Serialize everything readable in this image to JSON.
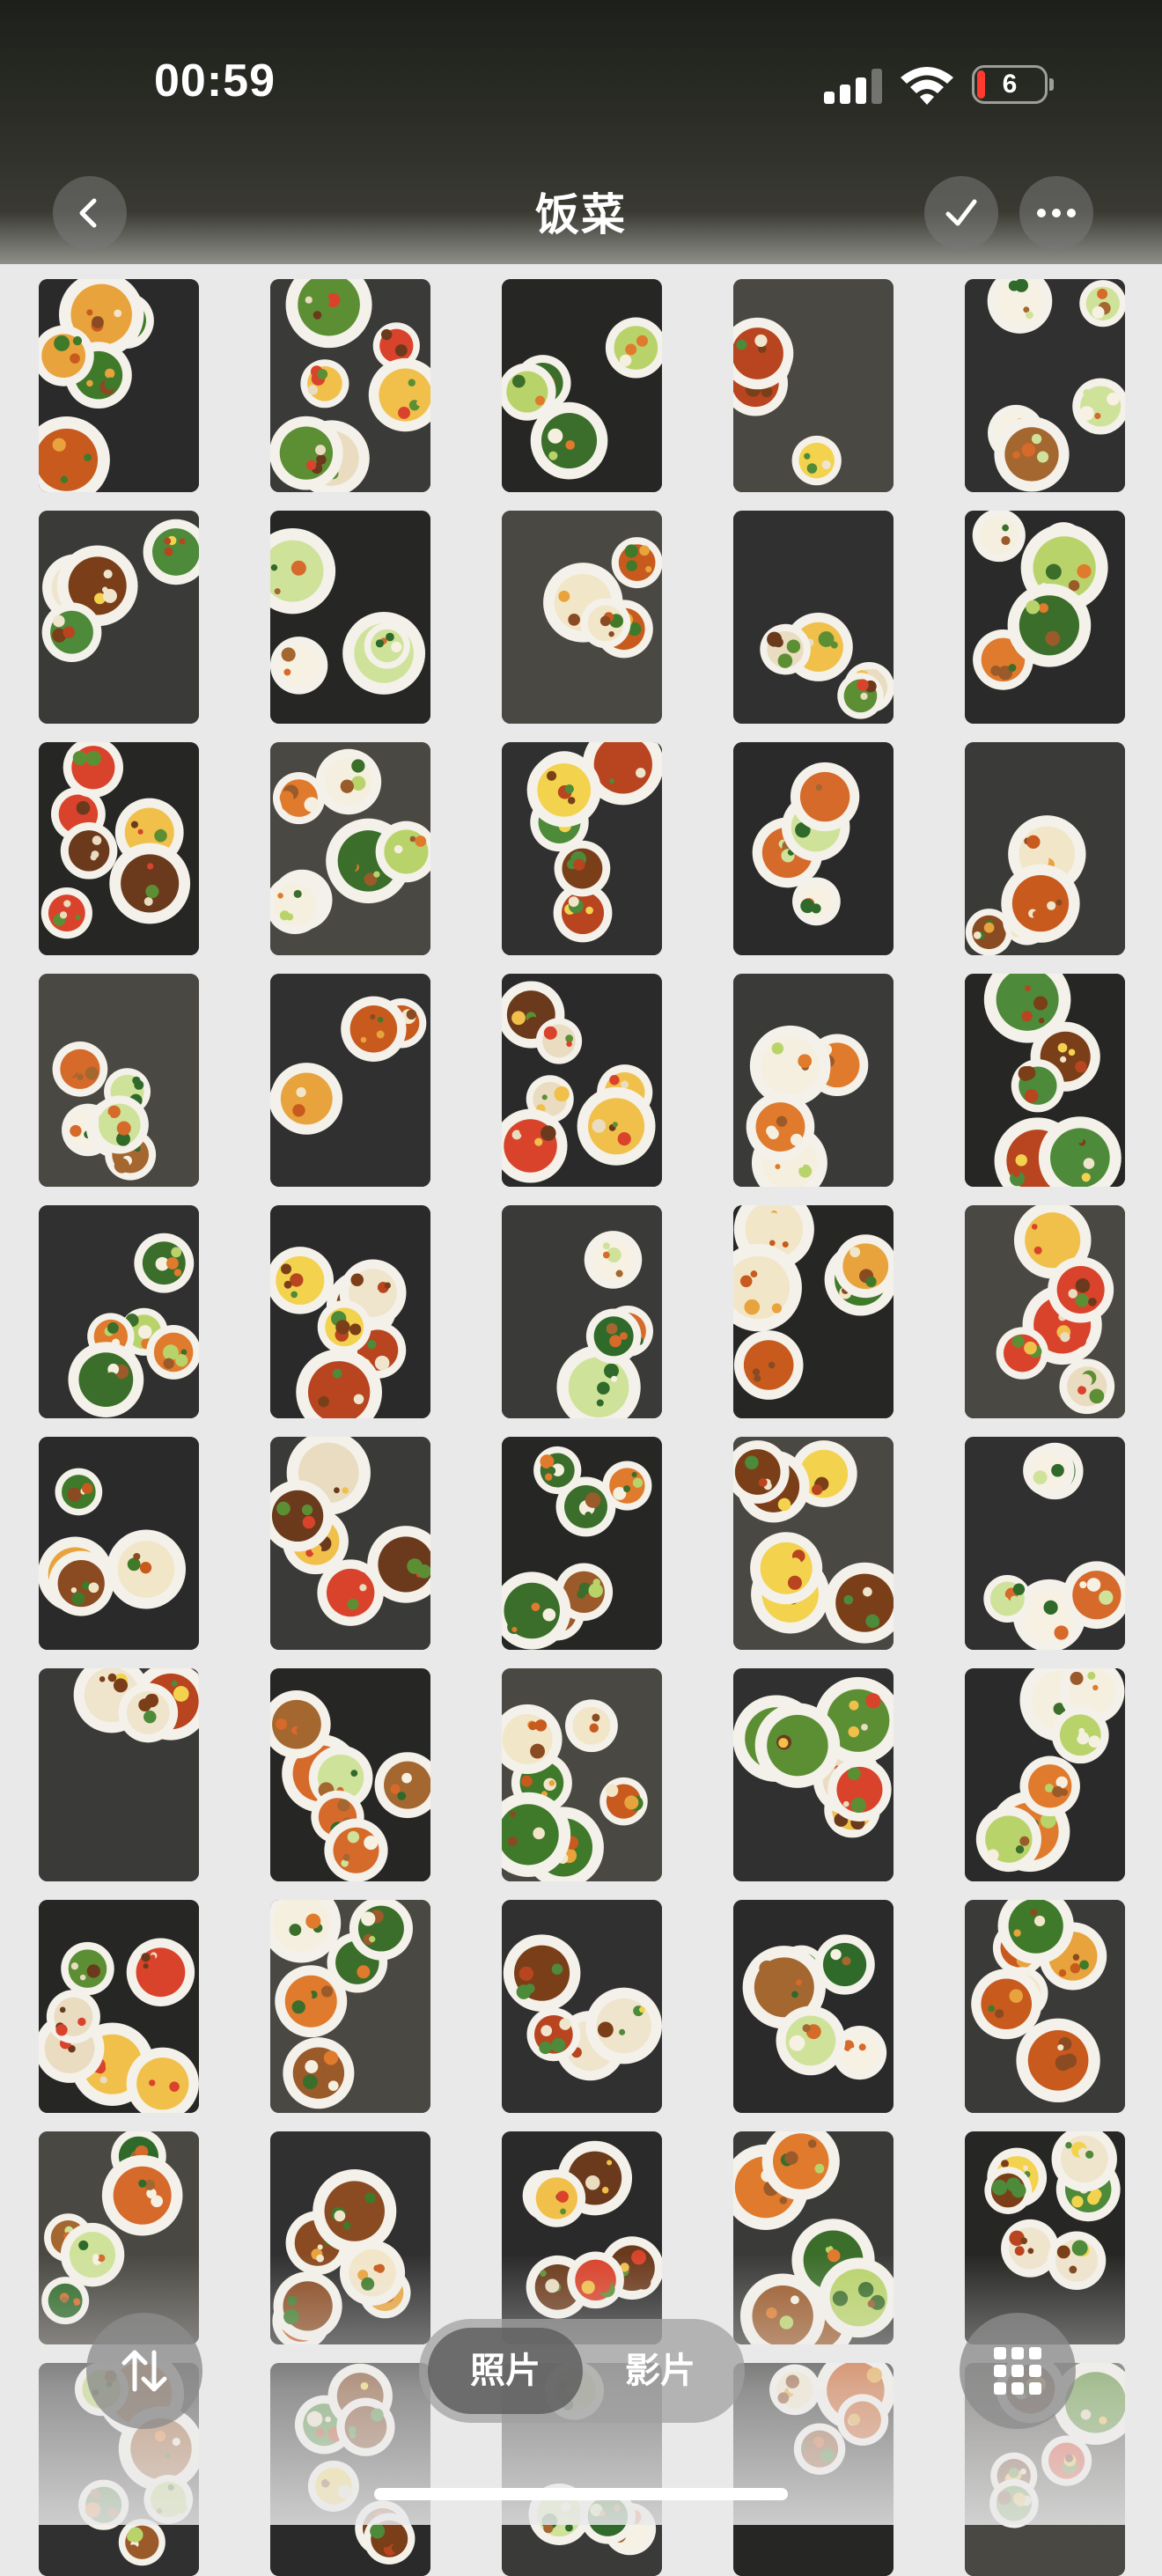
{
  "status_bar": {
    "time": "00:59",
    "battery_level": "6",
    "battery_color": "#ff3b30"
  },
  "nav": {
    "title": "饭菜",
    "back_icon": "chevron-left-icon",
    "select_icon": "checkmark-icon",
    "more_icon": "ellipsis-icon"
  },
  "segment": {
    "photos_label": "照片",
    "videos_label": "影片",
    "selected": "照片"
  },
  "controls": {
    "sort_icon": "sort-arrows-icon",
    "grid_icon": "grid-icon"
  },
  "grid": {
    "columns": 5,
    "thumbnail_content": "food-dish-photo"
  }
}
